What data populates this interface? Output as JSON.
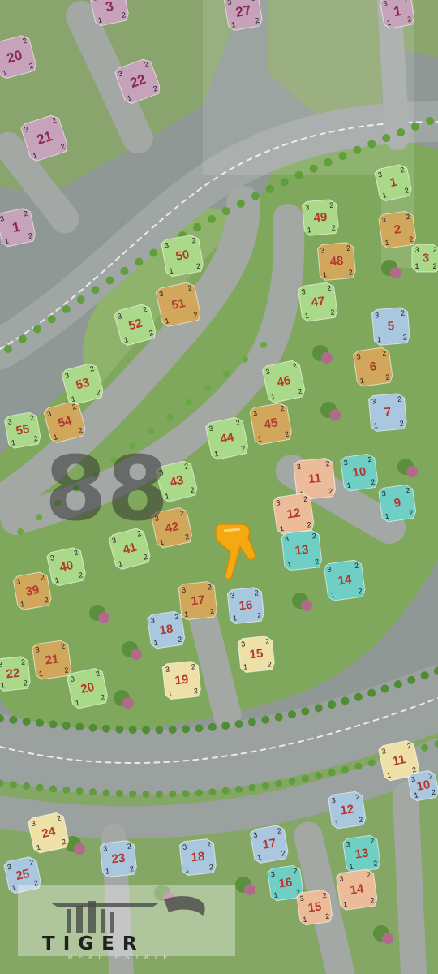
{
  "map": {
    "watermark_number": "88",
    "logo": {
      "name": "TIGER",
      "tagline": "REAL ESTATE"
    },
    "location_marker": "pointing-hand-icon",
    "colors": {
      "grass": "#7fa85c",
      "road": "#9aa09c",
      "green_building": "#a9d989",
      "tan_building": "#d1a75c",
      "blue_building": "#a9c7df",
      "cream_building": "#ede1a8",
      "teal_building": "#6fcfc4",
      "peach_building": "#ecbc9a",
      "mauve_building": "#c6a3bb",
      "label": "#b5372e",
      "marker": "#f4a913"
    },
    "buildings": [
      {
        "label": "20",
        "color": "mauve"
      },
      {
        "label": "3",
        "color": "mauve"
      },
      {
        "label": "27",
        "color": "mauve"
      },
      {
        "label": "22",
        "color": "mauve"
      },
      {
        "label": "21",
        "color": "mauve"
      },
      {
        "label": "1",
        "color": "mauve"
      },
      {
        "label": "1",
        "color": "mauve"
      },
      {
        "label": "1",
        "color": "green"
      },
      {
        "label": "49",
        "color": "green"
      },
      {
        "label": "2",
        "color": "tan"
      },
      {
        "label": "3",
        "color": "green"
      },
      {
        "label": "50",
        "color": "green"
      },
      {
        "label": "48",
        "color": "tan"
      },
      {
        "label": "51",
        "color": "tan"
      },
      {
        "label": "47",
        "color": "green"
      },
      {
        "label": "52",
        "color": "green"
      },
      {
        "label": "5",
        "color": "blue"
      },
      {
        "label": "6",
        "color": "tan"
      },
      {
        "label": "46",
        "color": "green"
      },
      {
        "label": "53",
        "color": "green"
      },
      {
        "label": "7",
        "color": "blue"
      },
      {
        "label": "55",
        "color": "green"
      },
      {
        "label": "54",
        "color": "tan"
      },
      {
        "label": "45",
        "color": "tan"
      },
      {
        "label": "44",
        "color": "green"
      },
      {
        "label": "11",
        "color": "peach"
      },
      {
        "label": "10",
        "color": "teal"
      },
      {
        "label": "43",
        "color": "green"
      },
      {
        "label": "9",
        "color": "teal"
      },
      {
        "label": "12",
        "color": "peach"
      },
      {
        "label": "42",
        "color": "tan"
      },
      {
        "label": "41",
        "color": "green"
      },
      {
        "label": "13",
        "color": "teal"
      },
      {
        "label": "40",
        "color": "green"
      },
      {
        "label": "14",
        "color": "teal"
      },
      {
        "label": "39",
        "color": "tan"
      },
      {
        "label": "17",
        "color": "tan"
      },
      {
        "label": "16",
        "color": "blue"
      },
      {
        "label": "18",
        "color": "blue"
      },
      {
        "label": "15",
        "color": "cream"
      },
      {
        "label": "21",
        "color": "tan"
      },
      {
        "label": "22",
        "color": "green"
      },
      {
        "label": "19",
        "color": "cream"
      },
      {
        "label": "20",
        "color": "green"
      },
      {
        "label": "11",
        "color": "cream"
      },
      {
        "label": "10",
        "color": "blue"
      },
      {
        "label": "12",
        "color": "blue"
      },
      {
        "label": "24",
        "color": "cream"
      },
      {
        "label": "17",
        "color": "blue"
      },
      {
        "label": "13",
        "color": "teal"
      },
      {
        "label": "23",
        "color": "blue"
      },
      {
        "label": "18",
        "color": "blue"
      },
      {
        "label": "25",
        "color": "blue"
      },
      {
        "label": "16",
        "color": "teal"
      },
      {
        "label": "14",
        "color": "peach"
      },
      {
        "label": "15",
        "color": "peach"
      }
    ]
  }
}
